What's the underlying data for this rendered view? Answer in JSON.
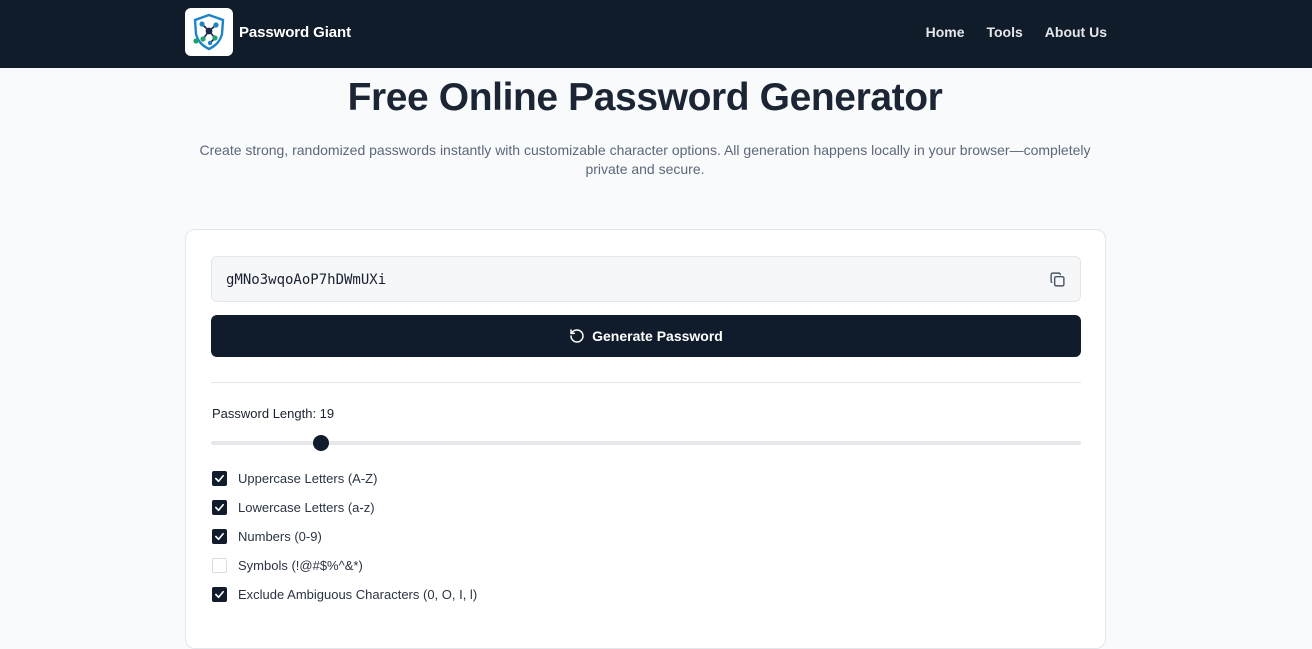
{
  "header": {
    "brand_name": "Password Giant",
    "logo_icon": "shield-network-icon",
    "nav": [
      {
        "label": "Home"
      },
      {
        "label": "Tools"
      },
      {
        "label": "About Us"
      }
    ]
  },
  "hero": {
    "title": "Free Online Password Generator",
    "description": "Create strong, randomized passwords instantly with customizable character options. All generation happens locally in your browser—completely private and secure."
  },
  "generator": {
    "password": "gMNo3wqoAoP7hDWmUXi",
    "copy_icon": "copy-icon",
    "generate_label": "Generate Password",
    "generate_icon": "refresh-icon",
    "length_label": "Password Length: 19",
    "length_value": 19,
    "length_fraction": 0.127,
    "options": [
      {
        "label": "Uppercase Letters (A-Z)",
        "checked": true
      },
      {
        "label": "Lowercase Letters (a-z)",
        "checked": true
      },
      {
        "label": "Numbers (0-9)",
        "checked": true
      },
      {
        "label": "Symbols (!@#$%^&*)",
        "checked": false
      },
      {
        "label": "Exclude Ambiguous Characters (0, O, I, l)",
        "checked": true
      }
    ]
  },
  "colors": {
    "navbar": "#111c2a",
    "primary_button": "#101c2b",
    "page_bg": "#f8fafc"
  }
}
